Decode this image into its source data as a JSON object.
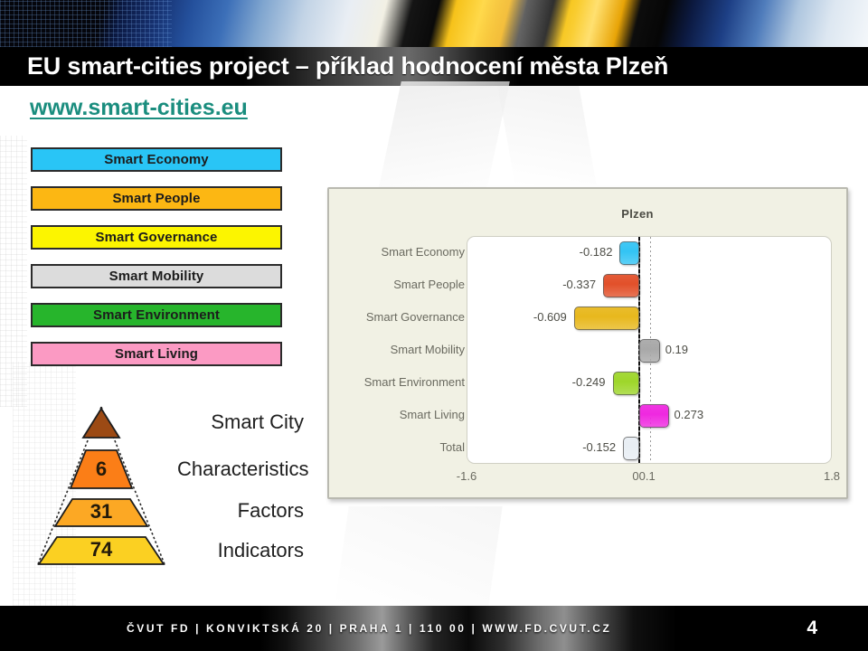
{
  "slide": {
    "title": "EU smart-cities project – příklad hodnocení města Plzeň",
    "subtitle_link": "www.smart-cities.eu"
  },
  "legend": {
    "items": [
      {
        "label": "Smart Economy",
        "color": "#29c5f6"
      },
      {
        "label": "Smart People",
        "color": "#fcb713"
      },
      {
        "label": "Smart Governance",
        "color": "#fcf500"
      },
      {
        "label": "Smart Mobility",
        "color": "#dcdcdc"
      },
      {
        "label": "Smart Environment",
        "color": "#27b52c"
      },
      {
        "label": "Smart Living",
        "color": "#fb9ac3"
      }
    ]
  },
  "pyramid": {
    "levels": [
      {
        "value": "",
        "label": "Smart City",
        "color": "#9c4a14"
      },
      {
        "value": "6",
        "label": "Characteristics",
        "color": "#fb7e17"
      },
      {
        "value": "31",
        "label": "Factors",
        "color": "#fca824"
      },
      {
        "value": "74",
        "label": "Indicators",
        "color": "#fbd022"
      }
    ]
  },
  "chart_data": {
    "type": "bar",
    "orientation": "horizontal",
    "title": "Plzen",
    "xlabel": "",
    "ylabel": "",
    "categories": [
      "Smart Economy",
      "Smart People",
      "Smart Governance",
      "Smart Mobility",
      "Smart Environment",
      "Smart Living",
      "Total"
    ],
    "values": [
      -0.182,
      -0.337,
      -0.609,
      0.19,
      -0.249,
      0.273,
      -0.152
    ],
    "value_labels": [
      "-0.182",
      "-0.337",
      "-0.609",
      "0.19",
      "-0.249",
      "0.273",
      "-0.152"
    ],
    "colors": [
      "#33c4f4",
      "#e2502a",
      "#e8b81d",
      "#a8a8a8",
      "#9ed62a",
      "#ef28e0",
      "#e8eef4"
    ],
    "xlim": [
      -1.6,
      1.8
    ],
    "tick_labels": [
      "-1.6",
      "00.1",
      "1.8"
    ],
    "tick_values": [
      -1.6,
      0.05,
      1.8
    ],
    "grid": false,
    "legend": "none",
    "reference_line": 0.1,
    "zero_line": 0
  },
  "footer": {
    "text": "ČVUT FD  |  KONVIKTSKÁ 20  |  PRAHA 1  |  110 00  |  WWW.FD.CVUT.CZ",
    "page_number": "4"
  }
}
